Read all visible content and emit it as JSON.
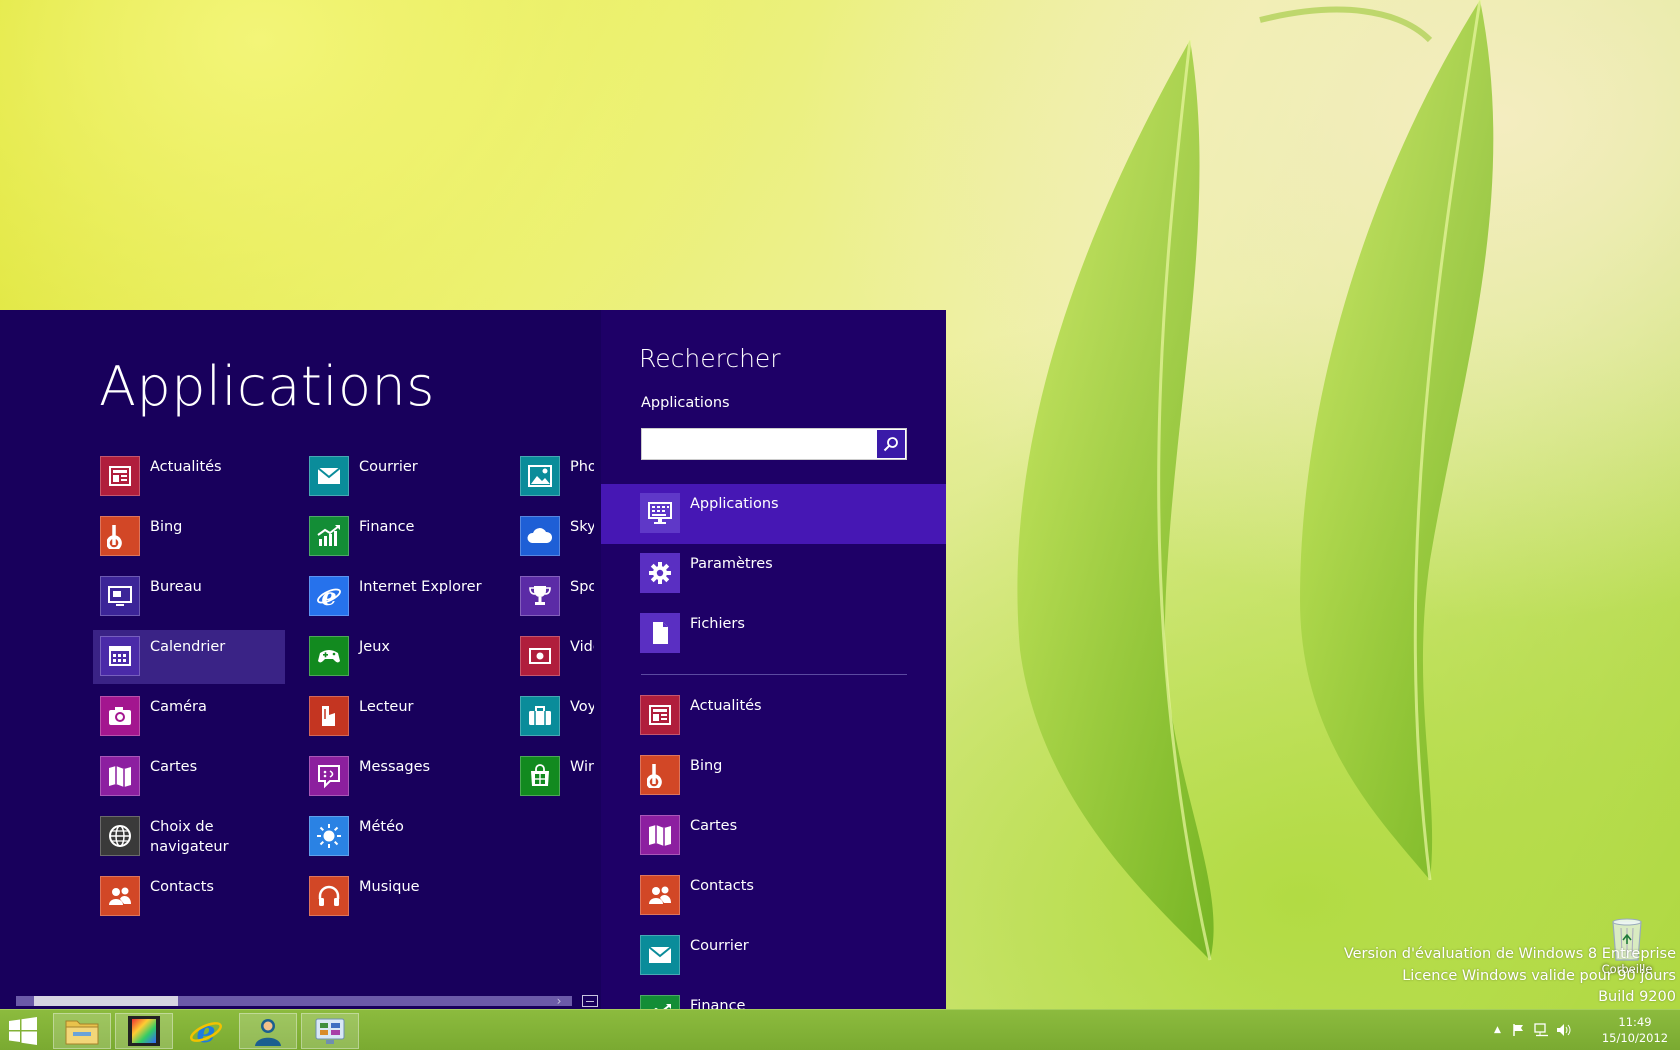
{
  "apps_screen": {
    "title": "Applications",
    "columns": [
      [
        {
          "label": "Actualités",
          "icon": "news-icon",
          "color": "#b01e3c"
        },
        {
          "label": "Bing",
          "icon": "bing-icon",
          "color": "#d24726"
        },
        {
          "label": "Bureau",
          "icon": "desktop-icon",
          "color": "#3c2598"
        },
        {
          "label": "Calendrier",
          "icon": "calendar-icon",
          "color": "#4a2aa8",
          "selected": true
        },
        {
          "label": "Caméra",
          "icon": "camera-icon",
          "color": "#a3168f"
        },
        {
          "label": "Cartes",
          "icon": "maps-icon",
          "color": "#8c1fa0"
        },
        {
          "label": "Choix de navigateur",
          "icon": "browser-choice-icon",
          "color": "#3a3a3a"
        },
        {
          "label": "Contacts",
          "icon": "contacts-icon",
          "color": "#d24726"
        }
      ],
      [
        {
          "label": "Courrier",
          "icon": "mail-icon",
          "color": "#0a8c9a"
        },
        {
          "label": "Finance",
          "icon": "finance-icon",
          "color": "#138d36"
        },
        {
          "label": "Internet Explorer",
          "icon": "internet-explorer-icon",
          "color": "#2672ec"
        },
        {
          "label": "Jeux",
          "icon": "games-icon",
          "color": "#128a1f"
        },
        {
          "label": "Lecteur",
          "icon": "reader-icon",
          "color": "#c43521"
        },
        {
          "label": "Messages",
          "icon": "messages-icon",
          "color": "#8c1f9e"
        },
        {
          "label": "Météo",
          "icon": "weather-icon",
          "color": "#2a82e4"
        },
        {
          "label": "Musique",
          "icon": "music-icon",
          "color": "#d24726"
        }
      ],
      [
        {
          "label": "Photos",
          "icon": "photos-icon",
          "color": "#0a8c9a"
        },
        {
          "label": "SkyDrive",
          "icon": "skydrive-icon",
          "color": "#1e5fd6"
        },
        {
          "label": "Sport",
          "icon": "sports-icon",
          "color": "#5b2ba6"
        },
        {
          "label": "Vidéo",
          "icon": "video-icon",
          "color": "#b01e3c"
        },
        {
          "label": "Voyage",
          "icon": "travel-icon",
          "color": "#0a8c9a"
        },
        {
          "label": "Windows Store",
          "icon": "store-icon",
          "color": "#128a1f"
        }
      ]
    ]
  },
  "search_pane": {
    "title": "Rechercher",
    "scope_label": "Applications",
    "input_value": "",
    "scopes": [
      {
        "label": "Applications",
        "icon": "applications-icon",
        "selected": true
      },
      {
        "label": "Paramètres",
        "icon": "settings-icon"
      },
      {
        "label": "Fichiers",
        "icon": "files-icon"
      }
    ],
    "results": [
      {
        "label": "Actualités",
        "icon": "news-icon",
        "color": "#b01e3c"
      },
      {
        "label": "Bing",
        "icon": "bing-icon",
        "color": "#d24726"
      },
      {
        "label": "Cartes",
        "icon": "maps-icon",
        "color": "#8c1fa0"
      },
      {
        "label": "Contacts",
        "icon": "contacts-icon",
        "color": "#d24726"
      },
      {
        "label": "Courrier",
        "icon": "mail-icon",
        "color": "#0a8c9a"
      },
      {
        "label": "Finance",
        "icon": "finance-icon",
        "color": "#138d36"
      }
    ]
  },
  "desktop": {
    "watermark": [
      "Version d'évaluation de Windows 8 Entreprise",
      "Licence Windows valide pour 90 jours",
      "Build 9200"
    ],
    "recycle_bin_label": "Corbeille"
  },
  "taskbar": {
    "buttons": [
      {
        "name": "start-button",
        "icon": "windows-logo-icon"
      },
      {
        "name": "file-explorer-button",
        "icon": "folder-icon"
      },
      {
        "name": "media-app-button",
        "icon": "film-icon"
      },
      {
        "name": "internet-explorer-button",
        "icon": "internet-explorer-icon"
      },
      {
        "name": "user-app-button",
        "icon": "user-icon"
      },
      {
        "name": "control-panel-button",
        "icon": "control-panel-icon"
      }
    ],
    "clock_time": "11:49",
    "clock_date": "15/10/2012"
  }
}
